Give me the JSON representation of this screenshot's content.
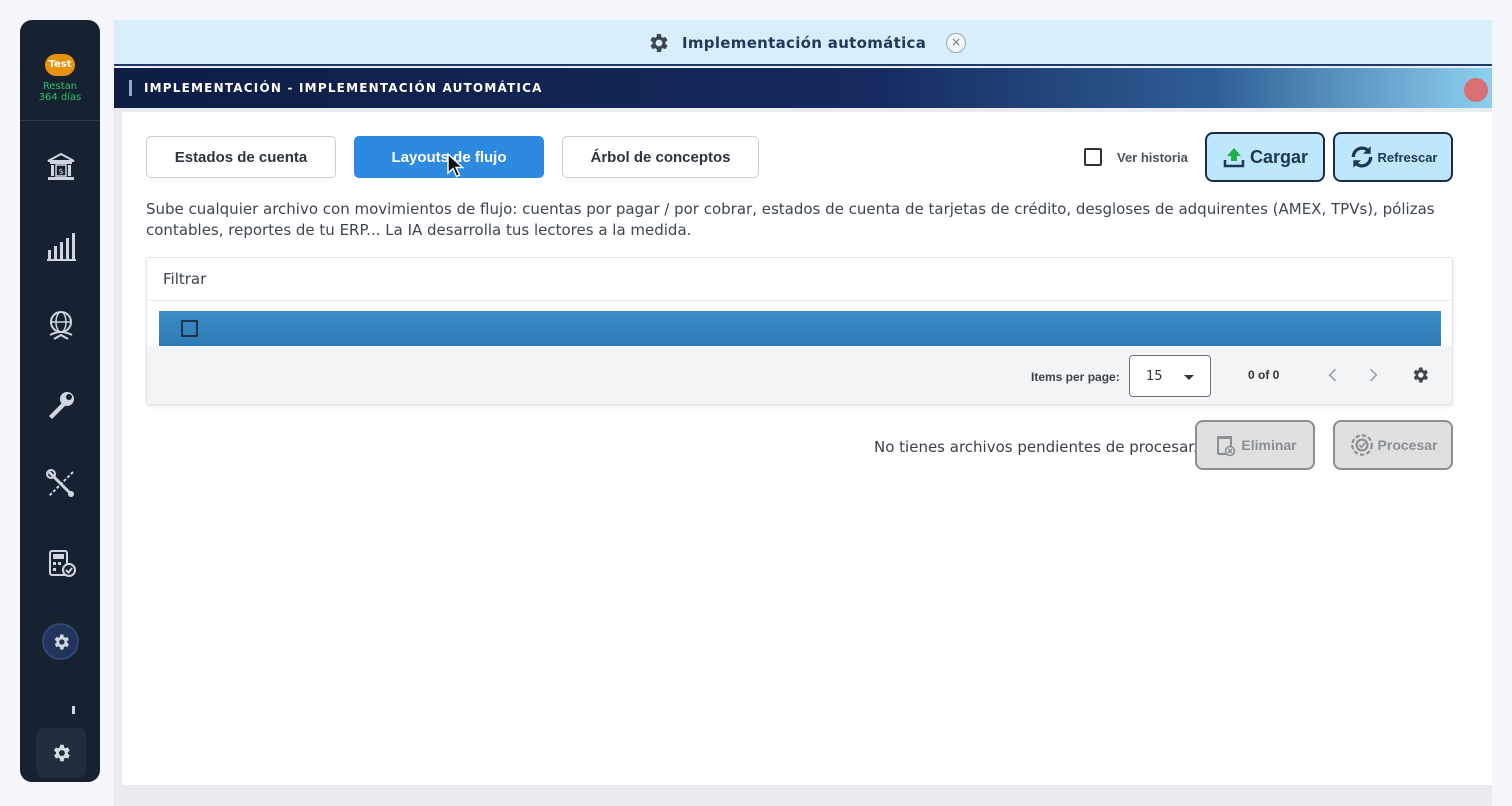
{
  "sidebar": {
    "badge": "Test",
    "days_left_line1": "Restan",
    "days_left_line2": "364 días",
    "items": [
      {
        "icon": "bank-icon"
      },
      {
        "icon": "bar-chart-icon"
      },
      {
        "icon": "money-globe-icon"
      },
      {
        "icon": "wrench-icon"
      },
      {
        "icon": "tools-icon"
      },
      {
        "icon": "calculator-check-icon"
      },
      {
        "icon": "gear-icon",
        "active": true
      }
    ],
    "bottom_icon": "gear-icon"
  },
  "tab": {
    "title": "Implementación automática",
    "close": "×"
  },
  "header": {
    "title": "IMPLEMENTACIÓN - IMPLEMENTACIÓN AUTOMÁTICA"
  },
  "tabs": [
    {
      "label": "Estados de cuenta",
      "active": false
    },
    {
      "label": "Layouts de flujo",
      "active": true
    },
    {
      "label": "Árbol de conceptos",
      "active": false
    }
  ],
  "ver_historia": {
    "label": "Ver historia",
    "checked": false
  },
  "actions": {
    "cargar": "Cargar",
    "refrescar": "Refrescar"
  },
  "description": "Sube cualquier archivo con movimientos de flujo: cuentas por pagar / por cobrar, estados de cuenta de tarjetas de crédito, desgloses de adquirentes (AMEX, TPVs), pólizas contables, reportes de tu ERP... La IA desarrolla tus lectores a la medida.",
  "filter": {
    "placeholder": "Filtrar"
  },
  "paginator": {
    "items_per_page_label": "Items per page:",
    "items_per_page": "15",
    "range": "0 of 0"
  },
  "footer": {
    "no_files": "No tienes archivos pendientes de procesar.",
    "eliminar": "Eliminar",
    "procesar": "Procesar"
  },
  "colors": {
    "primary": "#2e8ae0",
    "sidebar": "#172230",
    "header_dark": "#0d1d44",
    "action_bg": "#bfe7fb",
    "days_green": "#27c26b",
    "badge_orange": "#e8910f"
  }
}
